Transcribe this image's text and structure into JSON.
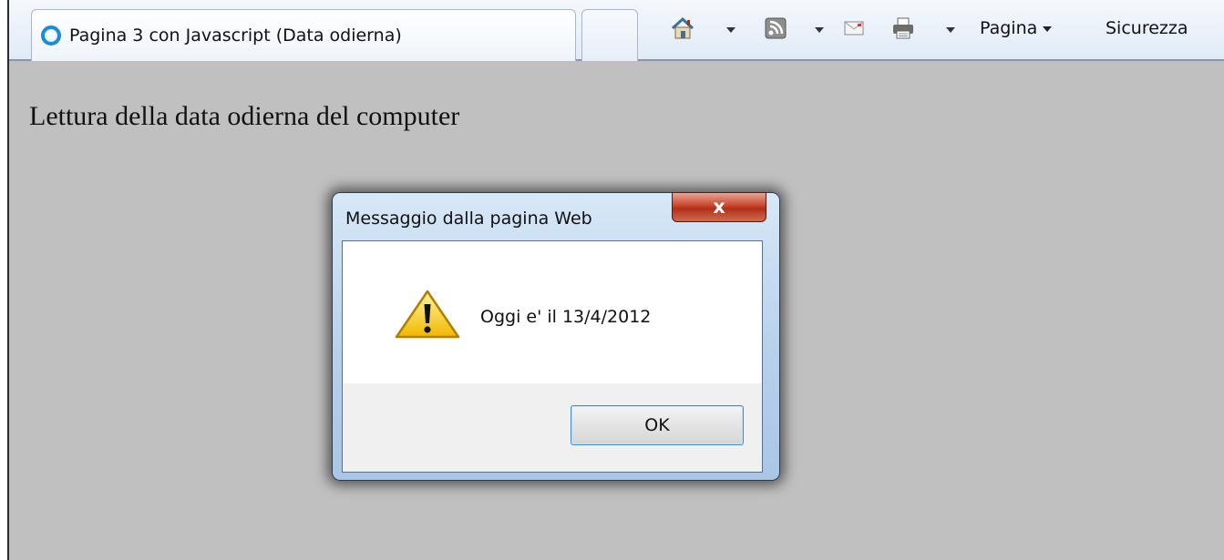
{
  "browser": {
    "tab_title": "Pagina 3 con Javascript (Data odierna)",
    "toolbar": {
      "icons": [
        "home-icon",
        "feeds-icon",
        "read-mail-icon",
        "print-icon"
      ],
      "page_menu_label": "Pagina",
      "safety_menu_label": "Sicurezza"
    }
  },
  "page": {
    "heading": "Lettura della data odierna del computer"
  },
  "dialog": {
    "title": "Messaggio dalla pagina Web",
    "close_label": "x",
    "icon": "warning-icon",
    "message": "Oggi e' il 13/4/2012",
    "ok_label": "OK"
  }
}
